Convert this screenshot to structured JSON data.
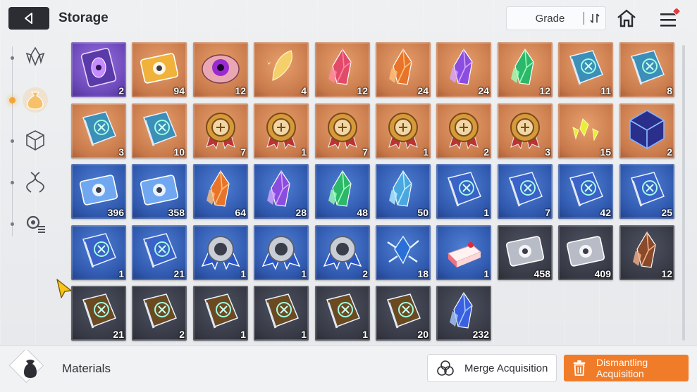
{
  "header": {
    "title": "Storage",
    "grade_label": "Grade"
  },
  "sidebar": {
    "items": [
      {
        "icon": "crystal-icon",
        "active": false
      },
      {
        "icon": "pouch-icon",
        "active": true
      },
      {
        "icon": "cube-icon",
        "active": false
      },
      {
        "icon": "dna-icon",
        "active": false
      },
      {
        "icon": "gear-list-icon",
        "active": false
      }
    ]
  },
  "colors": {
    "accent": "#f07c2a",
    "orange_rarity": "#c7784a",
    "purple_rarity": "#6a47b8",
    "blue_rarity": "#2f58ad",
    "gray_rarity": "#363944"
  },
  "inventory": {
    "rows": [
      [
        {
          "name": "purple-card",
          "tier": "purple",
          "icon": "card",
          "count": "2"
        },
        {
          "name": "gold-ticket",
          "tier": "orange",
          "icon": "ticket",
          "count": "94"
        },
        {
          "name": "eye-orb",
          "tier": "orange",
          "icon": "eye",
          "count": "12"
        },
        {
          "name": "gold-feather",
          "tier": "orange",
          "icon": "feather",
          "count": "4"
        },
        {
          "name": "red-crystal",
          "tier": "orange",
          "icon": "crystal",
          "count": "12"
        },
        {
          "name": "orange-crystal",
          "tier": "orange",
          "icon": "crystal",
          "count": "24"
        },
        {
          "name": "purple-crystal",
          "tier": "orange",
          "icon": "crystal",
          "count": "24"
        },
        {
          "name": "green-crystal",
          "tier": "orange",
          "icon": "crystal",
          "count": "12"
        },
        {
          "name": "sword-book",
          "tier": "orange",
          "icon": "book",
          "count": "11"
        },
        {
          "name": "shield-book",
          "tier": "orange",
          "icon": "book",
          "count": "8"
        }
      ],
      [
        {
          "name": "eye-book",
          "tier": "orange",
          "icon": "book",
          "count": "3"
        },
        {
          "name": "bolt-book",
          "tier": "orange",
          "icon": "book",
          "count": "10"
        },
        {
          "name": "sword-medal",
          "tier": "orange",
          "icon": "medal",
          "count": "7"
        },
        {
          "name": "shield-medal",
          "tier": "orange",
          "icon": "medal",
          "count": "1"
        },
        {
          "name": "arrow-medal",
          "tier": "orange",
          "icon": "medal",
          "count": "7"
        },
        {
          "name": "wing-medal",
          "tier": "orange",
          "icon": "medal",
          "count": "1"
        },
        {
          "name": "bolt-medal",
          "tier": "orange",
          "icon": "medal",
          "count": "2"
        },
        {
          "name": "globe-medal",
          "tier": "orange",
          "icon": "medal",
          "count": "3"
        },
        {
          "name": "yellow-shards",
          "tier": "orange",
          "icon": "shards",
          "count": "15"
        },
        {
          "name": "blue-cube",
          "tier": "orange",
          "icon": "cube",
          "count": "2"
        }
      ],
      [
        {
          "name": "blue-ticket",
          "tier": "blue",
          "icon": "ticket",
          "count": "396"
        },
        {
          "name": "compass-ticket",
          "tier": "blue",
          "icon": "ticket",
          "count": "358"
        },
        {
          "name": "orange-crystal-blue",
          "tier": "blue",
          "icon": "crystal",
          "count": "64"
        },
        {
          "name": "purple-crystal-blue",
          "tier": "blue",
          "icon": "crystal",
          "count": "28"
        },
        {
          "name": "green-crystal-blue",
          "tier": "blue",
          "icon": "crystal",
          "count": "48"
        },
        {
          "name": "cyan-crystal-blue",
          "tier": "blue",
          "icon": "crystal",
          "count": "50"
        },
        {
          "name": "sword-book-blue",
          "tier": "blue",
          "icon": "book",
          "count": "1"
        },
        {
          "name": "shield-book-blue",
          "tier": "blue",
          "icon": "book",
          "count": "7"
        },
        {
          "name": "eye-book-blue",
          "tier": "blue",
          "icon": "book",
          "count": "42"
        },
        {
          "name": "wing-book-blue",
          "tier": "blue",
          "icon": "book",
          "count": "25"
        }
      ],
      [
        {
          "name": "bolt-book-blue",
          "tier": "blue",
          "icon": "book",
          "count": "1"
        },
        {
          "name": "globe-book-blue",
          "tier": "blue",
          "icon": "book",
          "count": "21"
        },
        {
          "name": "shield-badge",
          "tier": "blue",
          "icon": "badge",
          "count": "1"
        },
        {
          "name": "eye-badge",
          "tier": "blue",
          "icon": "badge",
          "count": "1"
        },
        {
          "name": "wing-badge",
          "tier": "blue",
          "icon": "badge",
          "count": "2"
        },
        {
          "name": "ice-gem",
          "tier": "blue",
          "icon": "icegem",
          "count": "18"
        },
        {
          "name": "strawberry-cake",
          "tier": "blue",
          "icon": "cake",
          "count": "1"
        },
        {
          "name": "silver-ticket",
          "tier": "dark",
          "icon": "ticket",
          "count": "458"
        },
        {
          "name": "silver-compass-ticket",
          "tier": "dark",
          "icon": "ticket",
          "count": "409"
        },
        {
          "name": "brown-crystal",
          "tier": "dark",
          "icon": "crystal",
          "count": "12"
        }
      ],
      [
        {
          "name": "sword-book-gray",
          "tier": "dark",
          "icon": "book",
          "count": "21"
        },
        {
          "name": "shield-book-gray",
          "tier": "dark",
          "icon": "book",
          "count": "2"
        },
        {
          "name": "eye-book-gray",
          "tier": "dark",
          "icon": "book",
          "count": "1"
        },
        {
          "name": "wing-book-gray",
          "tier": "dark",
          "icon": "book",
          "count": "1"
        },
        {
          "name": "bolt-book-gray",
          "tier": "dark",
          "icon": "book",
          "count": "1"
        },
        {
          "name": "globe-book-gray",
          "tier": "dark",
          "icon": "book",
          "count": "20"
        },
        {
          "name": "blue-crystal-cluster",
          "tier": "dark",
          "icon": "crystal",
          "count": "232"
        }
      ]
    ]
  },
  "bottom": {
    "category_label": "Materials",
    "merge_label": "Merge Acquisition",
    "dismantle_label": "Dismantling Acquisition"
  }
}
